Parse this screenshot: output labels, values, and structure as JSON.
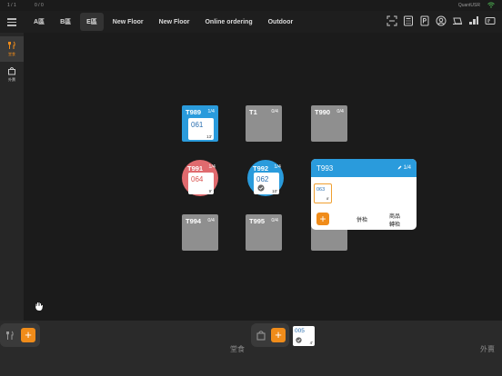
{
  "status": {
    "left1": "1 / 1",
    "left2": "0 / 0",
    "right": "QuantUSR"
  },
  "tabs": [
    {
      "label": "A區",
      "active": false
    },
    {
      "label": "B區",
      "active": false
    },
    {
      "label": "E區",
      "active": true
    },
    {
      "label": "New Floor",
      "active": false
    },
    {
      "label": "New Floor",
      "active": false
    },
    {
      "label": "Online ordering",
      "active": false
    },
    {
      "label": "Outdoor",
      "active": false
    }
  ],
  "sidebar": {
    "dine_in": "堂食",
    "takeout": "外賣"
  },
  "tables": [
    {
      "name": "T989",
      "seats": "1/4",
      "order": "061",
      "order_sub": "13'"
    },
    {
      "name": "T1",
      "seats": "0/4"
    },
    {
      "name": "T990",
      "seats": "0/4"
    },
    {
      "name": "T991",
      "seats": "1/4",
      "order": "064",
      "order_sub": "9'"
    },
    {
      "name": "T992",
      "seats": "1/4",
      "order": "062",
      "order_sub": "10'"
    },
    {
      "name": "T994",
      "seats": "0/4"
    },
    {
      "name": "T995",
      "seats": "0/4"
    }
  ],
  "popup": {
    "title": "T993",
    "seats": "1/4",
    "order": "063",
    "order_sub": "8'",
    "btn_merge": "併枱",
    "btn_transfer_l1": "商品",
    "btn_transfer_l2": "轉枱"
  },
  "bottom": {
    "dine_in_label": "堂食",
    "takeout_label": "外賣",
    "takeout_order": "005",
    "takeout_order_sub": "4'",
    "add_symbol": "+"
  }
}
